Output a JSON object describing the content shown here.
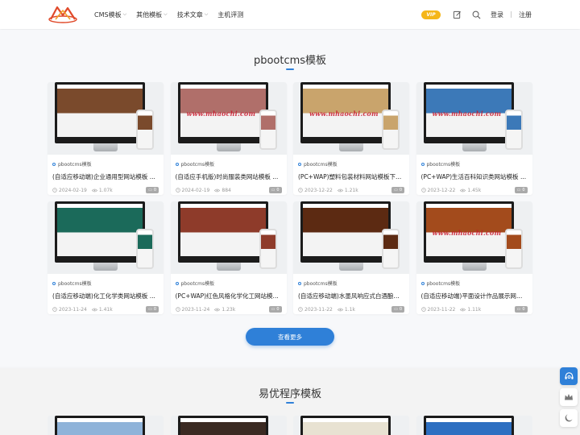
{
  "header": {
    "nav": [
      {
        "label": "CMS模板",
        "has_dropdown": true
      },
      {
        "label": "其他模板",
        "has_dropdown": true
      },
      {
        "label": "技术文章",
        "has_dropdown": true
      },
      {
        "label": "主机评测",
        "has_dropdown": false
      }
    ],
    "vip_label": "VIP",
    "login": "登录",
    "register": "注册"
  },
  "section1": {
    "title": "pbootcms模板",
    "cards": [
      {
        "category": "pbootcms模板",
        "title": "(自适应移动端)企业通用型网站模板 ...",
        "date": "2024-02-19",
        "views": "1.07k",
        "badge": "0",
        "theme": "#7a4a2c"
      },
      {
        "category": "pbootcms模板",
        "title": "(自适应手机版)时尚服装类网站模板 ...",
        "date": "2024-02-19",
        "views": "884",
        "badge": "0",
        "theme": "#b06f6a"
      },
      {
        "category": "pbootcms模板",
        "title": "(PC+WAP)塑料包装材料网站模板下...",
        "date": "2023-12-22",
        "views": "1.21k",
        "badge": "0",
        "theme": "#c9a46c"
      },
      {
        "category": "pbootcms模板",
        "title": "(PC+WAP)生活百科知识类网站模板 ...",
        "date": "2023-12-22",
        "views": "1.45k",
        "badge": "0",
        "theme": "#3c79b8"
      },
      {
        "category": "pbootcms模板",
        "title": "(自适应移动端)化工化学类网站模板 ...",
        "date": "2023-11-24",
        "views": "1.41k",
        "badge": "0",
        "theme": "#1b6a5a"
      },
      {
        "category": "pbootcms模板",
        "title": "(PC+WAP)红色风格化学化工网站模...",
        "date": "2023-11-24",
        "views": "1.23k",
        "badge": "0",
        "theme": "#8e3b2a"
      },
      {
        "category": "pbootcms模板",
        "title": "(自适应移动端)水墨风响应式白酒酿制...",
        "date": "2023-11-22",
        "views": "1.1k",
        "badge": "0",
        "theme": "#5c2a12"
      },
      {
        "category": "pbootcms模板",
        "title": "(自适应移动端)平面设计作品展示网站...",
        "date": "2023-11-22",
        "views": "1.11k",
        "badge": "0",
        "theme": "#a34b1c"
      }
    ],
    "more_button": "查看更多",
    "watermark": "www.mhaochi.com",
    "watermark_cards": [
      1,
      2,
      3,
      7
    ]
  },
  "section2": {
    "title": "易优程序模板",
    "themes": [
      "#8fb3d9",
      "#3b2a22",
      "#e8e2d2",
      "#2d6fc1"
    ]
  },
  "colors": {
    "accent": "#2f80d8",
    "vip": "#f5b619"
  },
  "side_buttons": [
    "customer-service-icon",
    "crown-icon",
    "dark-mode-icon"
  ]
}
